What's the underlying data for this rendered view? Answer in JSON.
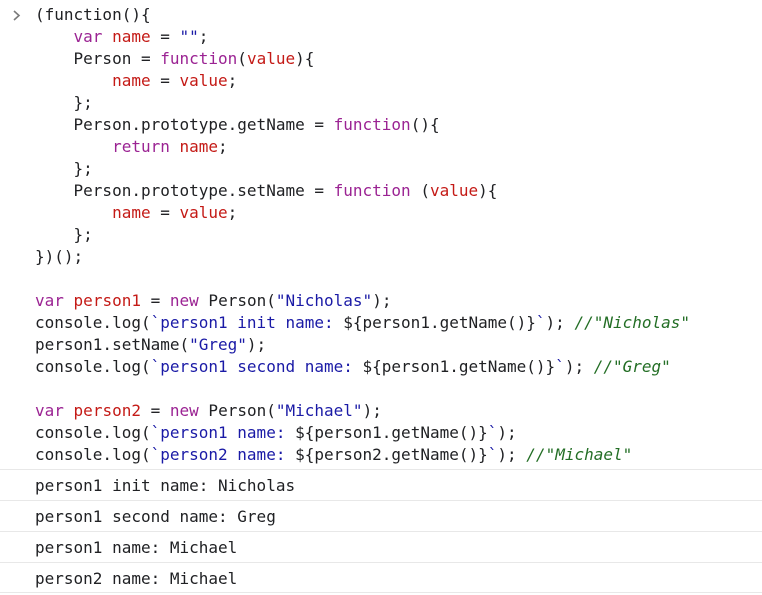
{
  "console": {
    "prompt_symbol": ">",
    "input_lines": [
      [
        {
          "t": "plain",
          "v": "(function(){"
        }
      ],
      [
        {
          "t": "plain",
          "v": "    "
        },
        {
          "t": "kw",
          "v": "var"
        },
        {
          "t": "plain",
          "v": " "
        },
        {
          "t": "var",
          "v": "name"
        },
        {
          "t": "plain",
          "v": " = "
        },
        {
          "t": "str",
          "v": "\"\""
        },
        {
          "t": "plain",
          "v": ";"
        }
      ],
      [
        {
          "t": "plain",
          "v": "    Person = "
        },
        {
          "t": "kw",
          "v": "function"
        },
        {
          "t": "plain",
          "v": "("
        },
        {
          "t": "var",
          "v": "value"
        },
        {
          "t": "plain",
          "v": "){"
        }
      ],
      [
        {
          "t": "plain",
          "v": "        "
        },
        {
          "t": "var",
          "v": "name"
        },
        {
          "t": "plain",
          "v": " = "
        },
        {
          "t": "var",
          "v": "value"
        },
        {
          "t": "plain",
          "v": ";"
        }
      ],
      [
        {
          "t": "plain",
          "v": "    };"
        }
      ],
      [
        {
          "t": "plain",
          "v": "    Person.prototype.getName = "
        },
        {
          "t": "kw",
          "v": "function"
        },
        {
          "t": "plain",
          "v": "(){"
        }
      ],
      [
        {
          "t": "plain",
          "v": "        "
        },
        {
          "t": "kw",
          "v": "return"
        },
        {
          "t": "plain",
          "v": " "
        },
        {
          "t": "var",
          "v": "name"
        },
        {
          "t": "plain",
          "v": ";"
        }
      ],
      [
        {
          "t": "plain",
          "v": "    };"
        }
      ],
      [
        {
          "t": "plain",
          "v": "    Person.prototype.setName = "
        },
        {
          "t": "kw",
          "v": "function"
        },
        {
          "t": "plain",
          "v": " ("
        },
        {
          "t": "var",
          "v": "value"
        },
        {
          "t": "plain",
          "v": "){"
        }
      ],
      [
        {
          "t": "plain",
          "v": "        "
        },
        {
          "t": "var",
          "v": "name"
        },
        {
          "t": "plain",
          "v": " = "
        },
        {
          "t": "var",
          "v": "value"
        },
        {
          "t": "plain",
          "v": ";"
        }
      ],
      [
        {
          "t": "plain",
          "v": "    };"
        }
      ],
      [
        {
          "t": "plain",
          "v": "})();"
        }
      ],
      [],
      [
        {
          "t": "kw",
          "v": "var"
        },
        {
          "t": "plain",
          "v": " "
        },
        {
          "t": "var",
          "v": "person1"
        },
        {
          "t": "plain",
          "v": " = "
        },
        {
          "t": "kw",
          "v": "new"
        },
        {
          "t": "plain",
          "v": " Person("
        },
        {
          "t": "str",
          "v": "\"Nicholas\""
        },
        {
          "t": "plain",
          "v": ");"
        }
      ],
      [
        {
          "t": "plain",
          "v": "console.log("
        },
        {
          "t": "tpl",
          "v": "`person1 init name: "
        },
        {
          "t": "plain",
          "v": "${person1.getName()}"
        },
        {
          "t": "tpl",
          "v": "`"
        },
        {
          "t": "plain",
          "v": "); "
        },
        {
          "t": "comment",
          "v": "//\"Nicholas\""
        }
      ],
      [
        {
          "t": "plain",
          "v": "person1.setName("
        },
        {
          "t": "str",
          "v": "\"Greg\""
        },
        {
          "t": "plain",
          "v": ");"
        }
      ],
      [
        {
          "t": "plain",
          "v": "console.log("
        },
        {
          "t": "tpl",
          "v": "`person1 second name: "
        },
        {
          "t": "plain",
          "v": "${person1.getName()}"
        },
        {
          "t": "tpl",
          "v": "`"
        },
        {
          "t": "plain",
          "v": "); "
        },
        {
          "t": "comment",
          "v": "//\"Greg\""
        }
      ],
      [],
      [
        {
          "t": "kw",
          "v": "var"
        },
        {
          "t": "plain",
          "v": " "
        },
        {
          "t": "var",
          "v": "person2"
        },
        {
          "t": "plain",
          "v": " = "
        },
        {
          "t": "kw",
          "v": "new"
        },
        {
          "t": "plain",
          "v": " Person("
        },
        {
          "t": "str",
          "v": "\"Michael\""
        },
        {
          "t": "plain",
          "v": ");"
        }
      ],
      [
        {
          "t": "plain",
          "v": "console.log("
        },
        {
          "t": "tpl",
          "v": "`person1 name: "
        },
        {
          "t": "plain",
          "v": "${person1.getName()}"
        },
        {
          "t": "tpl",
          "v": "`"
        },
        {
          "t": "plain",
          "v": ");"
        }
      ],
      [
        {
          "t": "plain",
          "v": "console.log("
        },
        {
          "t": "tpl",
          "v": "`person2 name: "
        },
        {
          "t": "plain",
          "v": "${person2.getName()}"
        },
        {
          "t": "tpl",
          "v": "`"
        },
        {
          "t": "plain",
          "v": "); "
        },
        {
          "t": "comment",
          "v": "//\"Michael\""
        }
      ]
    ],
    "output_lines": [
      "person1 init name: Nicholas",
      "person1 second name: Greg",
      "person1 name: Michael",
      "person2 name: Michael"
    ]
  }
}
